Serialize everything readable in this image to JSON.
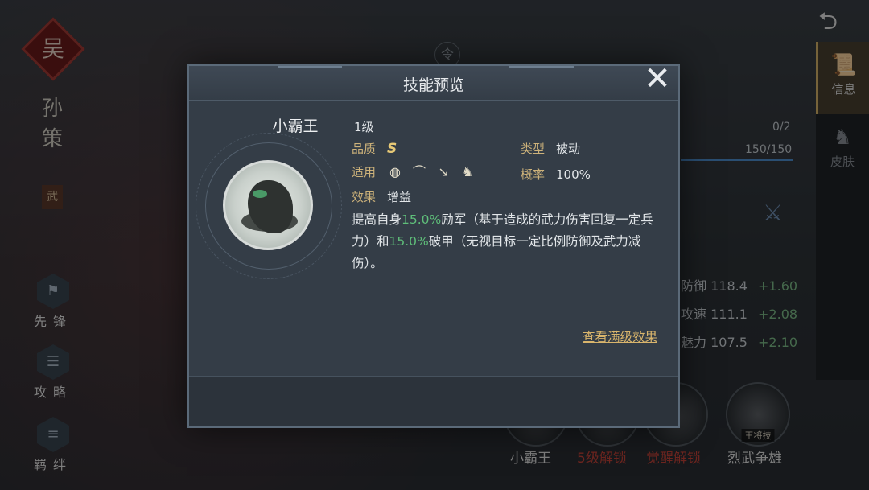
{
  "background": {
    "faction": "吴",
    "hero_name": "孙策",
    "hero_tag": "武",
    "side_buttons": [
      {
        "icon": "flag-icon",
        "label": "先锋"
      },
      {
        "icon": "scroll-icon",
        "label": "攻略"
      },
      {
        "icon": "bond-icon",
        "label": "羁绊"
      }
    ],
    "right_tabs": [
      {
        "icon": "info-scroll-icon",
        "label": "信息",
        "active": true
      },
      {
        "icon": "skin-figure-icon",
        "label": "皮肤",
        "active": false
      }
    ],
    "top_center_icon": "令",
    "counter": "0/2",
    "troops": "150/150",
    "stats": [
      {
        "name": "防御",
        "value": "118.4",
        "plus": "+1.60"
      },
      {
        "name": "攻速",
        "value": "111.1",
        "plus": "+2.08"
      },
      {
        "name": "魅力",
        "value": "107.5",
        "plus": "+2.10"
      }
    ],
    "skills": [
      {
        "label": "小霸王",
        "badge": "",
        "color": "#e6e6e6"
      },
      {
        "label": "5级解锁",
        "badge": "",
        "color": "#c9443a"
      },
      {
        "label": "觉醒解锁",
        "badge": "",
        "color": "#c9443a"
      },
      {
        "label": "烈武争雄",
        "badge": "王将技",
        "color": "#e6e6e6"
      }
    ]
  },
  "modal": {
    "title": "技能预览",
    "skill_name": "小霸王",
    "level": "1级",
    "quality_label": "品质",
    "quality_value": "S",
    "type_label": "类型",
    "type_value": "被动",
    "apply_label": "适用",
    "apply_icons": [
      "shield-unit-icon",
      "bow-unit-icon",
      "spear-unit-icon",
      "cavalry-unit-icon"
    ],
    "rate_label": "概率",
    "rate_value": "100%",
    "effect_label": "效果",
    "effect_value": "增益",
    "desc": {
      "p1": "提高自身",
      "v1": "15.0%",
      "p2": "励军（基于造成的武力伤害回复一定兵力）和",
      "v2": "15.0%",
      "p3": "破甲（无视目标一定比例防御及武力减伤）。"
    },
    "full_effect_link": "查看满级效果",
    "highlight_color": "#5fbf7a"
  }
}
